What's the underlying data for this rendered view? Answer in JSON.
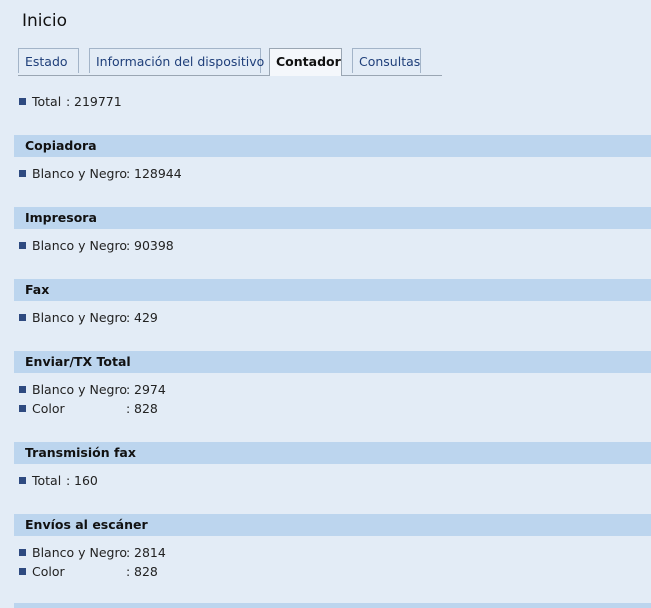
{
  "page_title": "Inicio",
  "tabs": [
    {
      "label": "Estado"
    },
    {
      "label": "Información del dispositivo"
    },
    {
      "label": "Contador"
    },
    {
      "label": "Consultas"
    }
  ],
  "total": {
    "label": "Total",
    "sep": ":",
    "value": "219771"
  },
  "sections": [
    {
      "title": "Copiadora",
      "rows": [
        {
          "label": "Blanco y Negro",
          "sep": ":",
          "value": "128944"
        }
      ]
    },
    {
      "title": "Impresora",
      "rows": [
        {
          "label": "Blanco y Negro",
          "sep": ":",
          "value": "90398"
        }
      ]
    },
    {
      "title": "Fax",
      "rows": [
        {
          "label": "Blanco y Negro",
          "sep": ":",
          "value": "429"
        }
      ]
    },
    {
      "title": "Enviar/TX Total",
      "rows": [
        {
          "label": "Blanco y Negro",
          "sep": ":",
          "value": "2974"
        },
        {
          "label": "Color",
          "sep": ":",
          "value": "828"
        }
      ]
    },
    {
      "title": "Transmisión fax",
      "rows": [
        {
          "label": "Total",
          "sep": ":",
          "value": "160"
        }
      ]
    },
    {
      "title": "Envíos al escáner",
      "rows": [
        {
          "label": "Blanco y Negro",
          "sep": ":",
          "value": "2814"
        },
        {
          "label": "Color",
          "sep": ":",
          "value": "828"
        }
      ]
    }
  ]
}
